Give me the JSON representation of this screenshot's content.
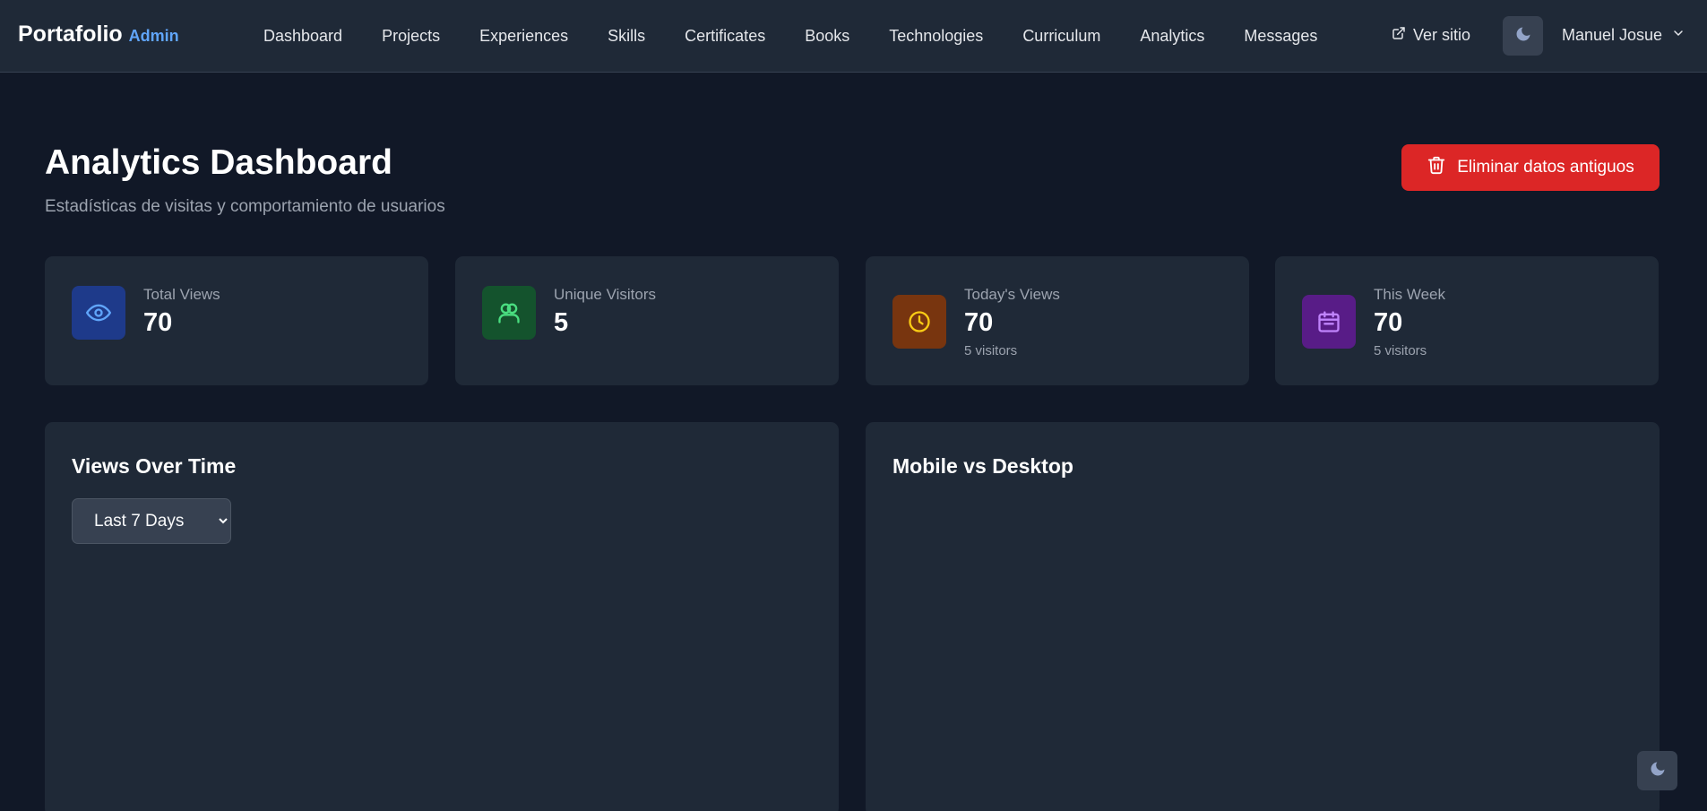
{
  "brand": {
    "name": "Portafolio",
    "tag": "Admin"
  },
  "nav": {
    "items": [
      {
        "label": "Dashboard"
      },
      {
        "label": "Projects"
      },
      {
        "label": "Experiences"
      },
      {
        "label": "Skills"
      },
      {
        "label": "Certificates"
      },
      {
        "label": "Books"
      },
      {
        "label": "Technologies"
      },
      {
        "label": "Curriculum"
      },
      {
        "label": "Analytics"
      },
      {
        "label": "Messages"
      }
    ],
    "view_site": "Ver sitio",
    "user_name": "Manuel Josue"
  },
  "header": {
    "title": "Analytics Dashboard",
    "subtitle": "Estadísticas de visitas y comportamiento de usuarios",
    "delete_button": "Eliminar datos antiguos"
  },
  "stats": [
    {
      "label": "Total Views",
      "value": "70",
      "sub": "",
      "icon": "eye-icon",
      "icon_bg": "#1e3a8a",
      "icon_color": "#60a5fa"
    },
    {
      "label": "Unique Visitors",
      "value": "5",
      "sub": "",
      "icon": "users-icon",
      "icon_bg": "#14532d",
      "icon_color": "#4ade80"
    },
    {
      "label": "Today's Views",
      "value": "70",
      "sub": "5 visitors",
      "icon": "clock-icon",
      "icon_bg": "#78350f",
      "icon_color": "#facc15"
    },
    {
      "label": "This Week",
      "value": "70",
      "sub": "5 visitors",
      "icon": "calendar-icon",
      "icon_bg": "#581c87",
      "icon_color": "#c084fc"
    }
  ],
  "panels": {
    "views_over_time": {
      "title": "Views Over Time",
      "range_selected": "Last 7 Days"
    },
    "mobile_vs_desktop": {
      "title": "Mobile vs Desktop"
    }
  },
  "colors": {
    "background": "#111827",
    "card": "#1f2937",
    "accent": "#60a5fa",
    "danger": "#dc2626"
  }
}
